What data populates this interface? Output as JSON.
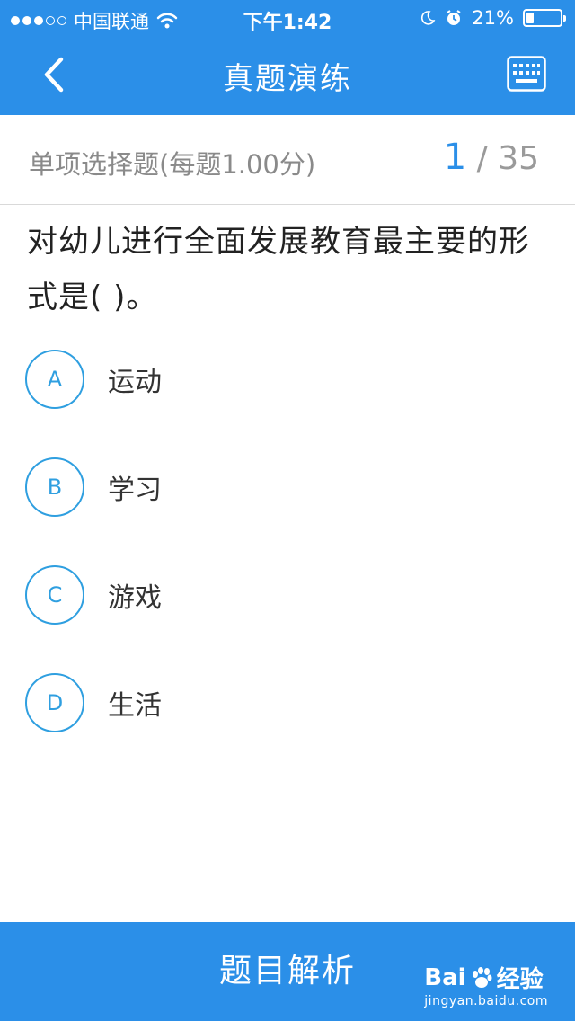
{
  "status_bar": {
    "carrier": "中国联通",
    "time": "下午1:42",
    "battery": "21%",
    "battery_level": 0.21,
    "signal_strength": 3
  },
  "header": {
    "title": "真题演练",
    "back_icon": "chevron-left-icon",
    "keyboard_icon": "keyboard-icon"
  },
  "question_meta": {
    "type_label": "单项选择题(每题1.00分)",
    "current": "1",
    "separator": "/",
    "total": "35"
  },
  "question": {
    "text": "对幼儿进行全面发展教育最主要的形式是(   )。"
  },
  "options": [
    {
      "letter": "A",
      "text": "运动"
    },
    {
      "letter": "B",
      "text": "学习"
    },
    {
      "letter": "C",
      "text": "游戏"
    },
    {
      "letter": "D",
      "text": "生活"
    }
  ],
  "footer": {
    "analysis_button": "题目解析",
    "watermark_brand": "Bai",
    "watermark_product": "经验",
    "watermark_url": "jingyan.baidu.com"
  },
  "colors": {
    "primary": "#2b8fe8",
    "option_accent": "#2f9fe0"
  }
}
